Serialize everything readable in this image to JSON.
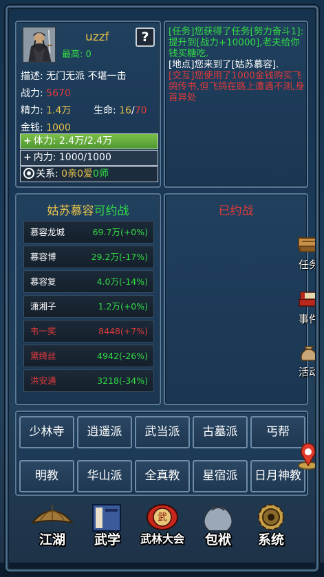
{
  "player": {
    "name": "uzzf",
    "help_label": "?",
    "rank_label": "最高:",
    "rank_value": "0",
    "desc_label": "描述:",
    "desc_value": "无门无派 不堪一击",
    "power_label": "战力:",
    "power_value": "5670",
    "energy_label": "精力:",
    "energy_value": "1.4万",
    "life_label": "生命:",
    "life_current": "16",
    "life_sep": "/",
    "life_max": "70",
    "money_label": "金钱:",
    "money_value": "1000",
    "stamina_icon": "+",
    "stamina_text": "体力: 2.4万/2.4万",
    "inner_icon": "+",
    "inner_text": "内力: 1000/1000",
    "relation_label": "关系:",
    "relation_qin_num": "0",
    "relation_qin": "亲",
    "relation_ai_num": "0",
    "relation_ai": "爱",
    "relation_shi_num": "0",
    "relation_shi": "师"
  },
  "log": {
    "entry1": "[任务]您获得了任务[努力奋斗1]:提升到[战力+10000],老夫给你钱买糖吃.",
    "entry2": "[地点]您来到了[姑苏慕容].",
    "entry3": "[交互]您使用了1000金钱购买飞鸽传书,但飞鸽在路上遭遇不测,身首异处"
  },
  "opponents": {
    "title_location": "姑苏慕容",
    "title_suffix": "可约战",
    "items": [
      {
        "name": "慕容龙城",
        "power": "69.7万(+0%)",
        "color": "white"
      },
      {
        "name": "慕容博",
        "power": "29.2万(-17%)",
        "color": "white"
      },
      {
        "name": "慕容复",
        "power": "4.0万(-14%)",
        "color": "white"
      },
      {
        "name": "潇湘子",
        "power": "1.2万(+0%)",
        "color": "white"
      },
      {
        "name": "韦一笑",
        "power": "8448(+7%)",
        "color": "red"
      },
      {
        "name": "黛绮丝",
        "power": "4942(-26%)",
        "color": "red-green"
      },
      {
        "name": "洪安通",
        "power": "3218(-34%)",
        "color": "red-green"
      }
    ]
  },
  "fought": {
    "title": "已约战"
  },
  "side": {
    "task": "任务",
    "event": "事件",
    "activity": "活动"
  },
  "sects": {
    "row1": [
      "少林寺",
      "逍遥派",
      "武当派",
      "古墓派",
      "丐帮"
    ],
    "row2": [
      "明教",
      "华山派",
      "全真教",
      "星宿派",
      "日月神教"
    ]
  },
  "menu": {
    "jianghu": "江湖",
    "wuxue": "武学",
    "wulin": "武林大会",
    "wulin_badge": "武",
    "baofu": "包袱",
    "xitong": "系统"
  },
  "colors": {
    "accent_yellow": "#e8c24a",
    "danger_red": "#e03a3a",
    "positive_green": "#33dd44",
    "stamina_bar": "#6cb042"
  }
}
